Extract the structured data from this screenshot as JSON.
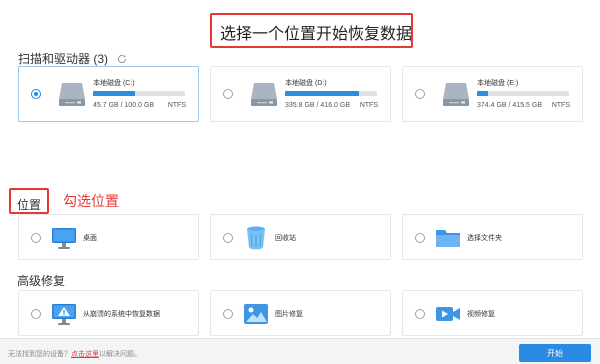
{
  "title": "选择一个位置开始恢复数据",
  "drives_section": {
    "label": "扫描和驱动器",
    "count": "(3)"
  },
  "drives": [
    {
      "name": "本地磁盘 (C:)",
      "usage": "45.7 GB / 100.0 GB",
      "fs": "NTFS",
      "used_fraction": 0.457,
      "selected": true
    },
    {
      "name": "本地磁盘 (D:)",
      "usage": "335.8 GB / 416.0 GB",
      "fs": "NTFS",
      "used_fraction": 0.807,
      "selected": false
    },
    {
      "name": "本地磁盘 (E:)",
      "usage": "374.4 GB / 415.5 GB",
      "fs": "NTFS",
      "used_fraction": 0.119,
      "selected": false
    }
  ],
  "annotation": "勾选位置",
  "location_section": {
    "label": "位置"
  },
  "locations": [
    {
      "label": "桌面",
      "icon": "desktop-icon"
    },
    {
      "label": "回收站",
      "icon": "recycle-bin-icon"
    },
    {
      "label": "选择文件夹",
      "icon": "folder-icon"
    }
  ],
  "advanced_section": {
    "label": "高级修复"
  },
  "advanced": [
    {
      "label": "从崩溃的系统中恢复数据",
      "icon": "crashed-system-icon"
    },
    {
      "label": "图片修复",
      "icon": "image-repair-icon"
    },
    {
      "label": "视频修复",
      "icon": "video-repair-icon"
    }
  ],
  "footer": {
    "prefix": "无法找到您的设备？",
    "link": "点击这里",
    "suffix": "以解决问题。"
  },
  "start_button": "开始",
  "colors": {
    "accent": "#2b8ae2",
    "annotation": "#e53935"
  }
}
